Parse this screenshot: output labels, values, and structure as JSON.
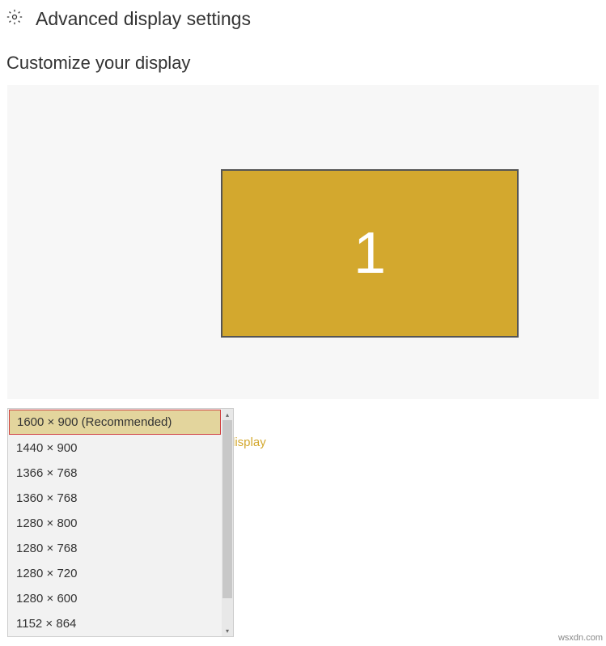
{
  "header": {
    "title": "Advanced display settings"
  },
  "subtitle": "Customize your display",
  "monitor": {
    "number": "1"
  },
  "link": {
    "partial_text": "display"
  },
  "dropdown": {
    "items": [
      "1600 × 900 (Recommended)",
      "1440 × 900",
      "1366 × 768",
      "1360 × 768",
      "1280 × 800",
      "1280 × 768",
      "1280 × 720",
      "1280 × 600",
      "1152 × 864"
    ]
  },
  "watermark": "wsxdn.com"
}
